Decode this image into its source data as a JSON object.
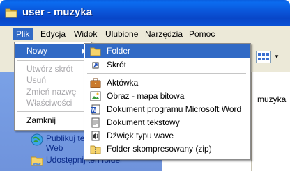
{
  "window": {
    "title": "user - muzyka"
  },
  "menubar": {
    "items": [
      {
        "label": "Plik",
        "active": true
      },
      {
        "label": "Edycja"
      },
      {
        "label": "Widok"
      },
      {
        "label": "Ulubione"
      },
      {
        "label": "Narzędzia"
      },
      {
        "label": "Pomoc"
      }
    ]
  },
  "file_menu": {
    "items": [
      {
        "label": "Nowy",
        "enabled": true,
        "highlighted": true,
        "has_submenu": true
      },
      {
        "label": "Utwórz skrót",
        "enabled": false
      },
      {
        "label": "Usuń",
        "enabled": false
      },
      {
        "label": "Zmień nazwę",
        "enabled": false
      },
      {
        "label": "Właściwości",
        "enabled": false
      },
      {
        "label": "Zamknij",
        "enabled": true
      }
    ]
  },
  "new_submenu": {
    "items": [
      {
        "label": "Folder",
        "icon": "folder-icon",
        "highlighted": true
      },
      {
        "label": "Skrót",
        "icon": "shortcut-icon"
      },
      {
        "label": "Aktówka",
        "icon": "briefcase-icon"
      },
      {
        "label": "Obraz - mapa bitowa",
        "icon": "bitmap-icon"
      },
      {
        "label": "Dokument programu Microsoft Word",
        "icon": "word-document-icon"
      },
      {
        "label": "Dokument tekstowy",
        "icon": "text-document-icon"
      },
      {
        "label": "Dźwięk typu wave",
        "icon": "wave-sound-icon"
      },
      {
        "label": "Folder skompresowany (zip)",
        "icon": "zip-folder-icon"
      }
    ]
  },
  "task_pane": {
    "publish_label_1": "Publikuj ten",
    "publish_label_2": "Web",
    "share_label": "Udostępnij ten folder"
  },
  "content": {
    "item_label": "muzyka"
  },
  "colors": {
    "title_bar": "#0a54d8",
    "menu_bar": "#ece9d8",
    "highlight": "#316ac5",
    "task_pane": "#7aa1e6"
  }
}
